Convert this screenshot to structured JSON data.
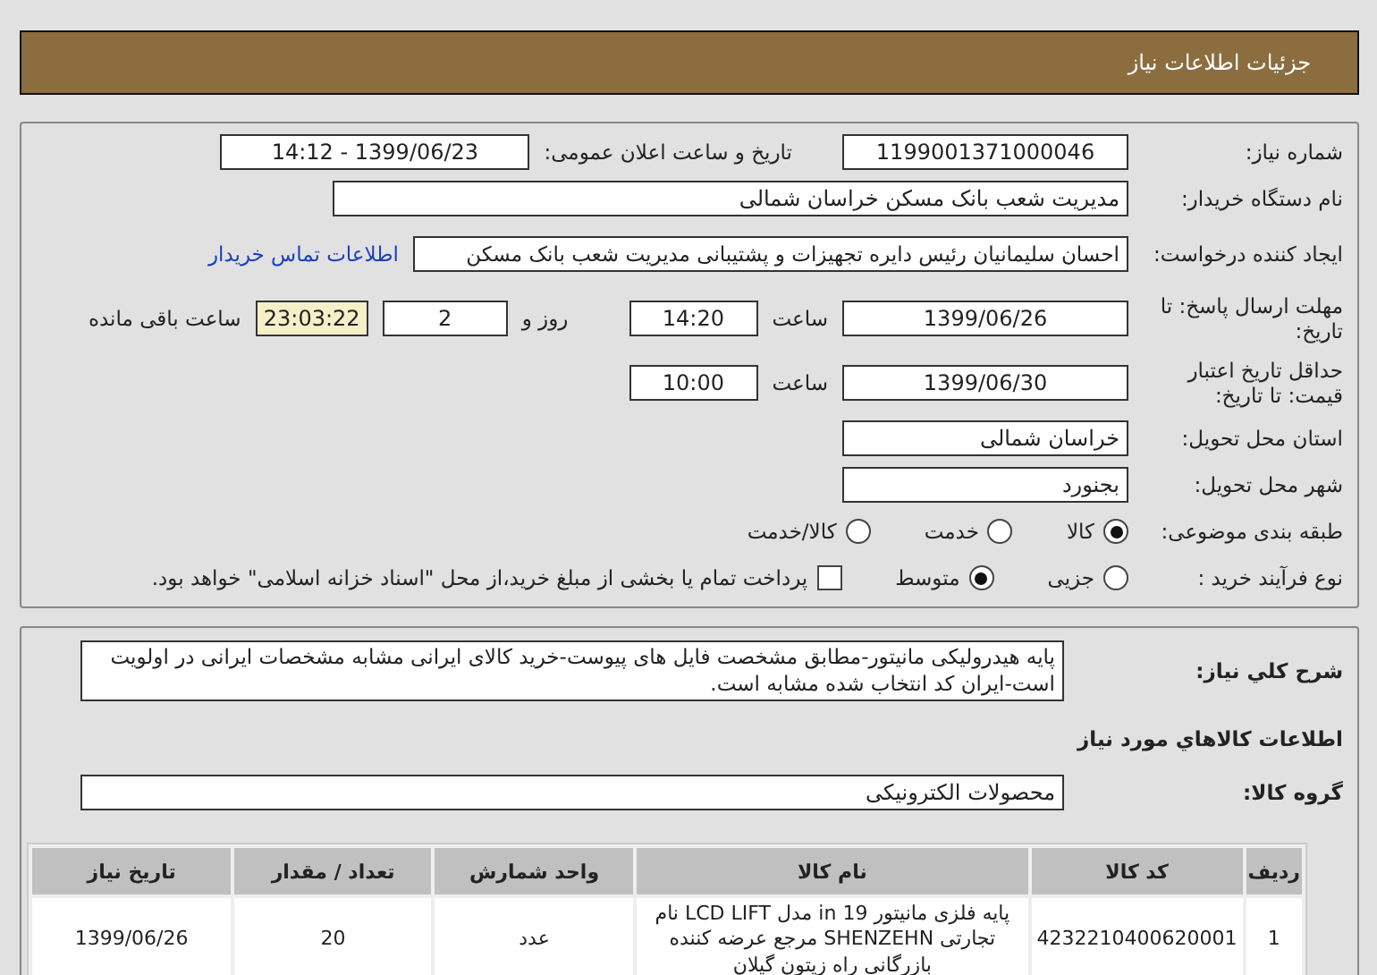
{
  "header": {
    "title": "جزئیات اطلاعات نیاز"
  },
  "need_number": {
    "label": "شماره نیاز:",
    "value": "1199001371000046"
  },
  "announce": {
    "label": "تاریخ و ساعت اعلان عمومی:",
    "value": "1399/06/23 - 14:12"
  },
  "buyer": {
    "label": "نام دستگاه خریدار:",
    "value": "مدیریت شعب بانک مسکن خراسان شمالی"
  },
  "requester": {
    "label": "ایجاد کننده درخواست:",
    "value": "احسان  سلیمانیان رئیس دایره تجهیزات و پشتیبانی مدیریت شعب بانک مسکن",
    "link": "اطلاعات تماس خریدار"
  },
  "deadline": {
    "label": "مهلت ارسال پاسخ: تا تاریخ:",
    "date": "1399/06/26",
    "time_label": "ساعت",
    "time": "14:20",
    "days": "2",
    "days_label": "روز و",
    "remaining": "23:03:22",
    "remaining_label": "ساعت باقی مانده"
  },
  "validity": {
    "label": "حداقل تاریخ اعتبار قیمت: تا تاریخ:",
    "date": "1399/06/30",
    "time_label": "ساعت",
    "time": "10:00"
  },
  "province": {
    "label": "استان محل تحویل:",
    "value": "خراسان شمالی"
  },
  "city": {
    "label": "شهر محل تحویل:",
    "value": "بجنورد"
  },
  "category": {
    "label": "طبقه بندی موضوعی:",
    "options": [
      {
        "label": "کالا",
        "selected": true
      },
      {
        "label": "خدمت",
        "selected": false
      },
      {
        "label": "کالا/خدمت",
        "selected": false
      }
    ]
  },
  "process": {
    "label": "نوع فرآیند خرید :",
    "options": [
      {
        "label": "جزیی",
        "selected": false
      },
      {
        "label": "متوسط",
        "selected": true
      }
    ],
    "payment": {
      "checked": false,
      "text": "پرداخت تمام یا بخشی از مبلغ خرید،از محل \"اسناد خزانه اسلامی\" خواهد بود."
    }
  },
  "description": {
    "label": "شرح کلي نیاز:",
    "value": "پایه هیدرولیکی مانیتور-مطابق مشخصت فایل های پیوست-خرید کالای ایرانی مشابه مشخصات ایرانی در اولویت است-ایران کد انتخاب شده مشابه است."
  },
  "goods_title": "اطلاعات کالاهاي مورد نیاز",
  "group": {
    "label": "گروه کالا:",
    "value": "محصولات الکترونیکی"
  },
  "table": {
    "columns": [
      "ردیف",
      "کد کالا",
      "نام کالا",
      "واحد شمارش",
      "تعداد / مقدار",
      "تاریخ نیاز"
    ],
    "rows": [
      [
        "1",
        "4232210400620001",
        "پایه فلزی مانیتور 19 in مدل LCD LIFT نام تجارتی SHENZEHN مرجع عرضه کننده بازرگانی راه زیتون گیلان",
        "عدد",
        "20",
        "1399/06/26"
      ]
    ]
  }
}
